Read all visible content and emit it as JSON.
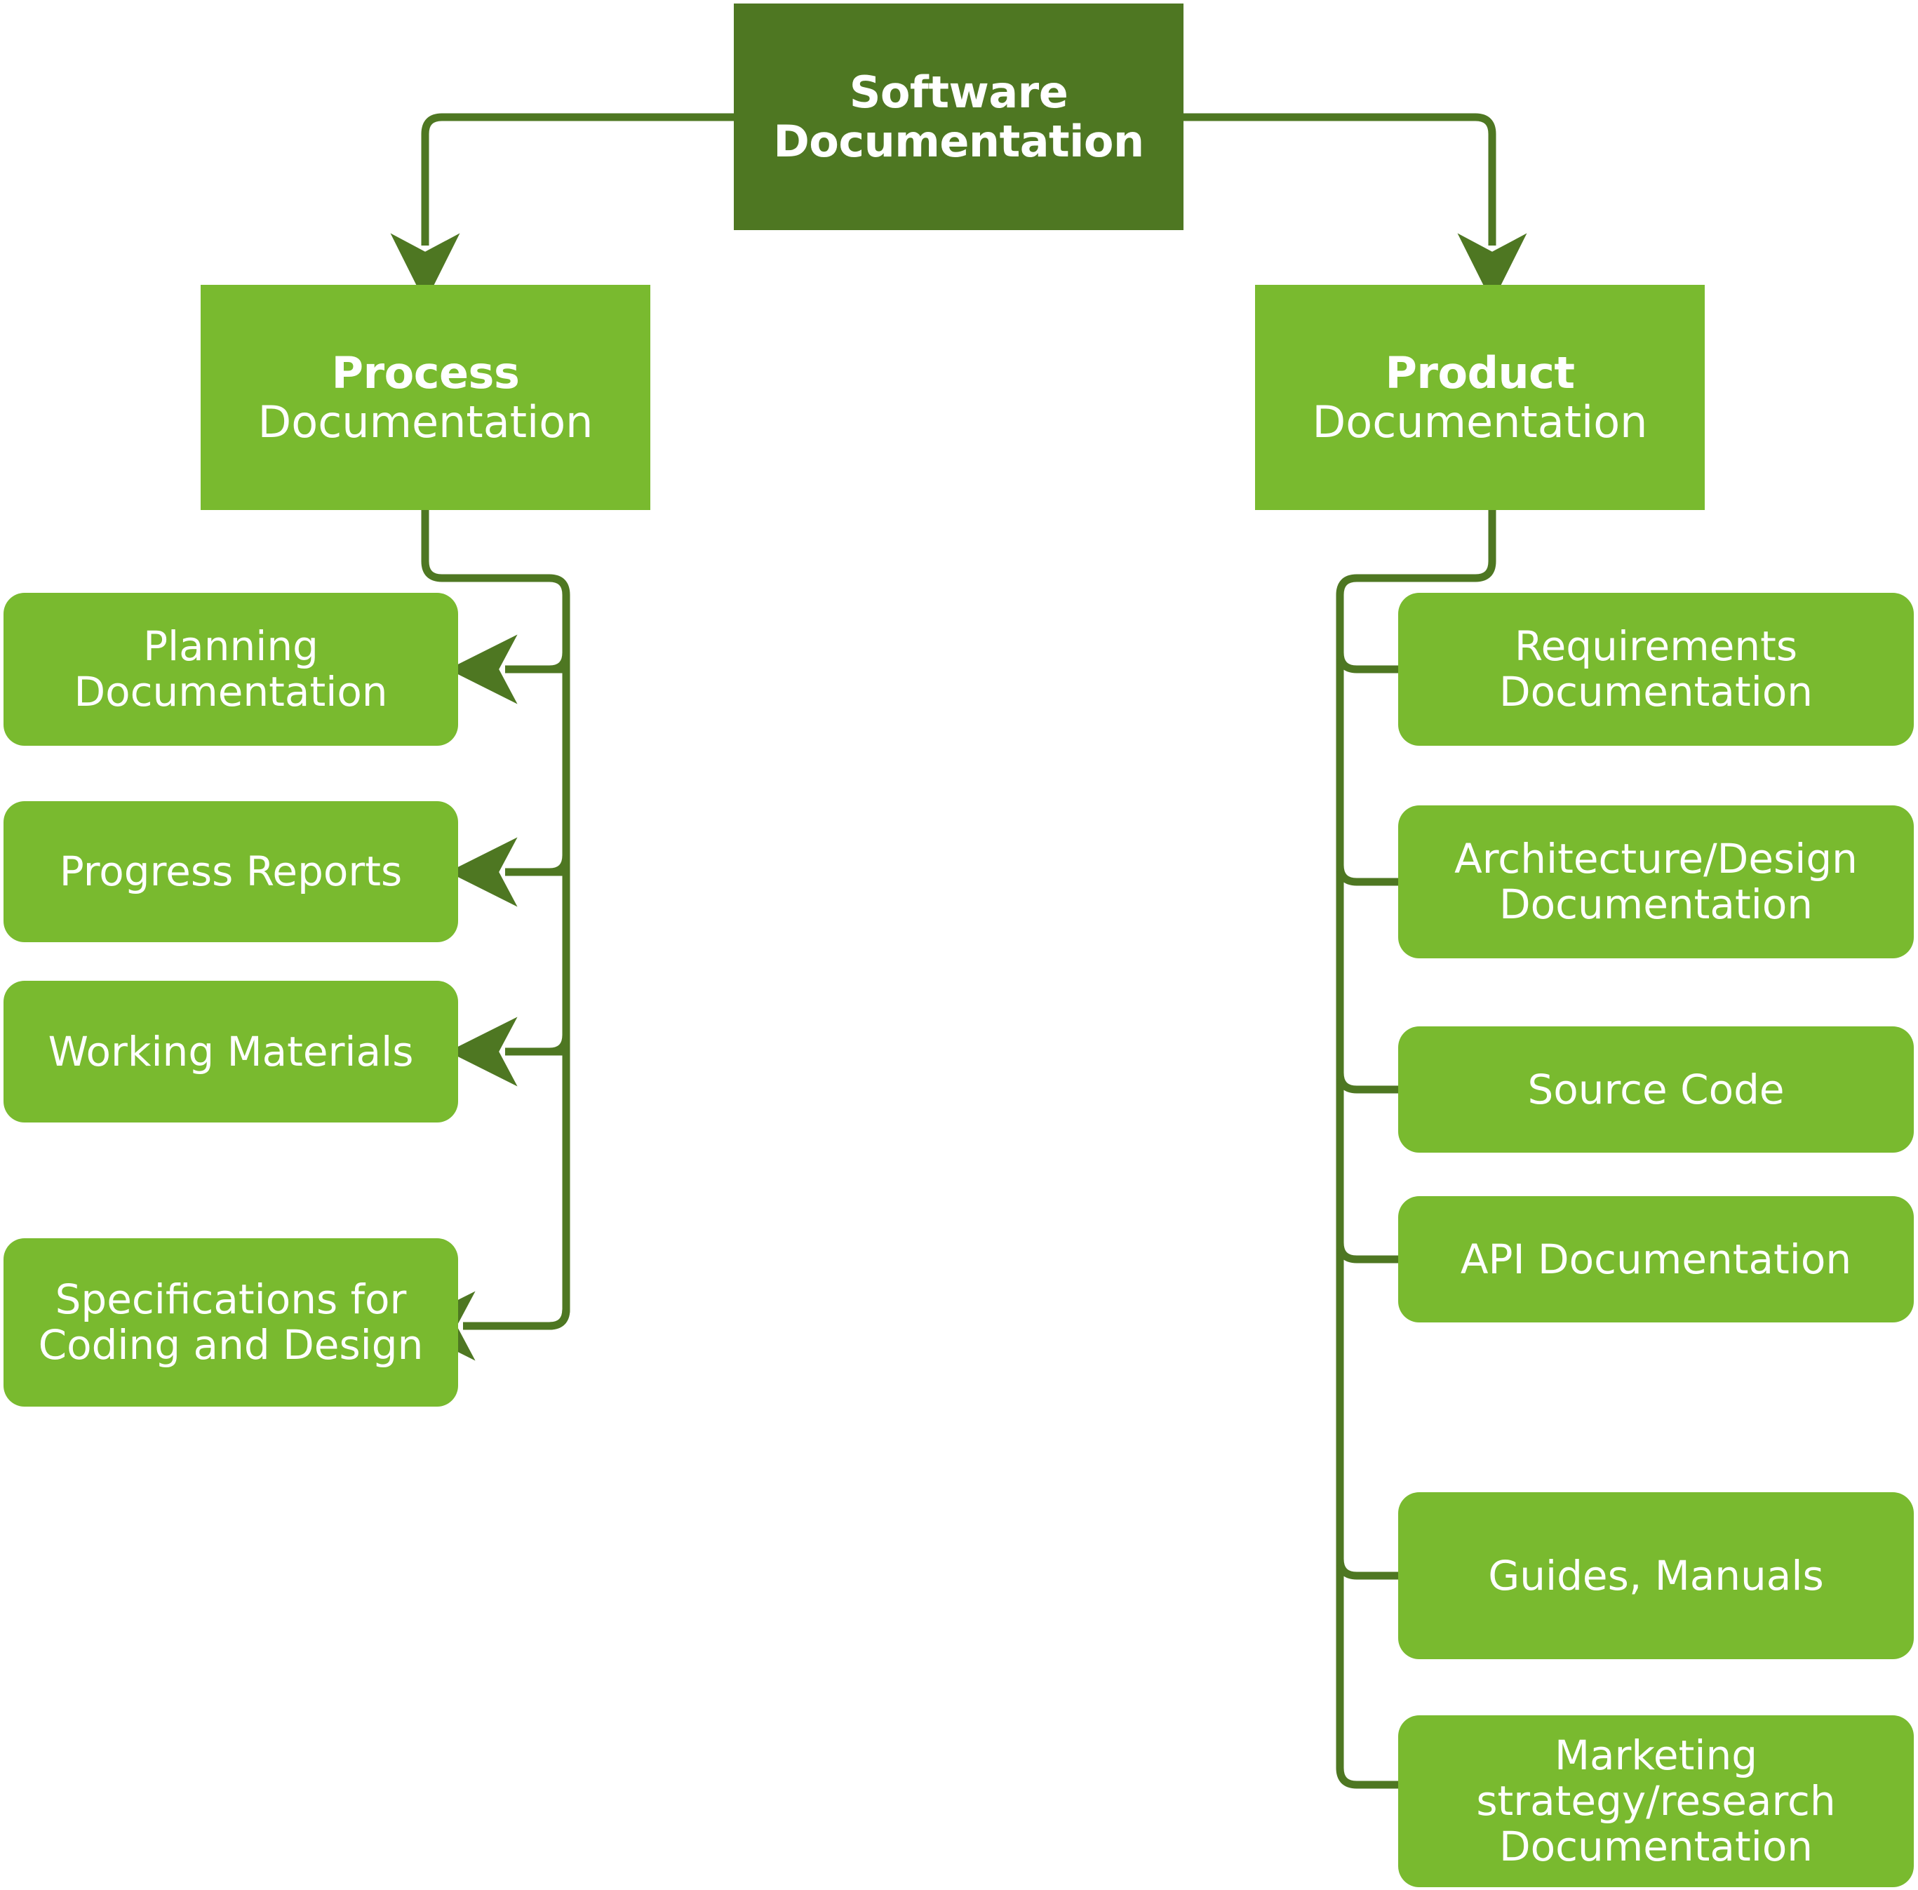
{
  "diagram": {
    "title": "Software Documentation",
    "colors": {
      "root_fill": "#4E7722",
      "node_fill": "#79BA2F",
      "connector": "#4E7722",
      "text": "#FFFFFF",
      "background": "#FFFFFF"
    },
    "root": {
      "line1": "Software",
      "line2": "Documentation"
    },
    "branches": [
      {
        "id": "process",
        "line1": "Process",
        "line2": "Documentation",
        "children": [
          {
            "id": "planning",
            "line1": "Planning",
            "line2": "Documentation",
            "line3": ""
          },
          {
            "id": "progress",
            "line1": "Progress Reports",
            "line2": "",
            "line3": ""
          },
          {
            "id": "working",
            "line1": "Working Materials",
            "line2": "",
            "line3": ""
          },
          {
            "id": "specs",
            "line1": "Specifications for",
            "line2": "Coding and Design",
            "line3": ""
          }
        ]
      },
      {
        "id": "product",
        "line1": "Product",
        "line2": "Documentation",
        "children": [
          {
            "id": "requirements",
            "line1": "Requirements",
            "line2": "Documentation",
            "line3": ""
          },
          {
            "id": "architecture",
            "line1": "Architecture/Design",
            "line2": "Documentation",
            "line3": ""
          },
          {
            "id": "source",
            "line1": "Source Code",
            "line2": "",
            "line3": ""
          },
          {
            "id": "api",
            "line1": "API Documentation",
            "line2": "",
            "line3": ""
          },
          {
            "id": "guides",
            "line1": "Guides, Manuals",
            "line2": "",
            "line3": ""
          },
          {
            "id": "marketing",
            "line1": "Marketing",
            "line2": "strategy/research",
            "line3": "Documentation"
          }
        ]
      }
    ]
  },
  "chart_data": {
    "type": "table",
    "title": "Software Documentation",
    "categories": [
      "Process Documentation",
      "Product Documentation"
    ],
    "series": [
      {
        "name": "Process Documentation",
        "values": [
          "Planning Documentation",
          "Progress Reports",
          "Working Materials",
          "Specifications for Coding and Design"
        ]
      },
      {
        "name": "Product Documentation",
        "values": [
          "Requirements Documentation",
          "Architecture/Design Documentation",
          "Source Code",
          "API Documentation",
          "Guides, Manuals",
          "Marketing strategy/research Documentation"
        ]
      }
    ]
  }
}
